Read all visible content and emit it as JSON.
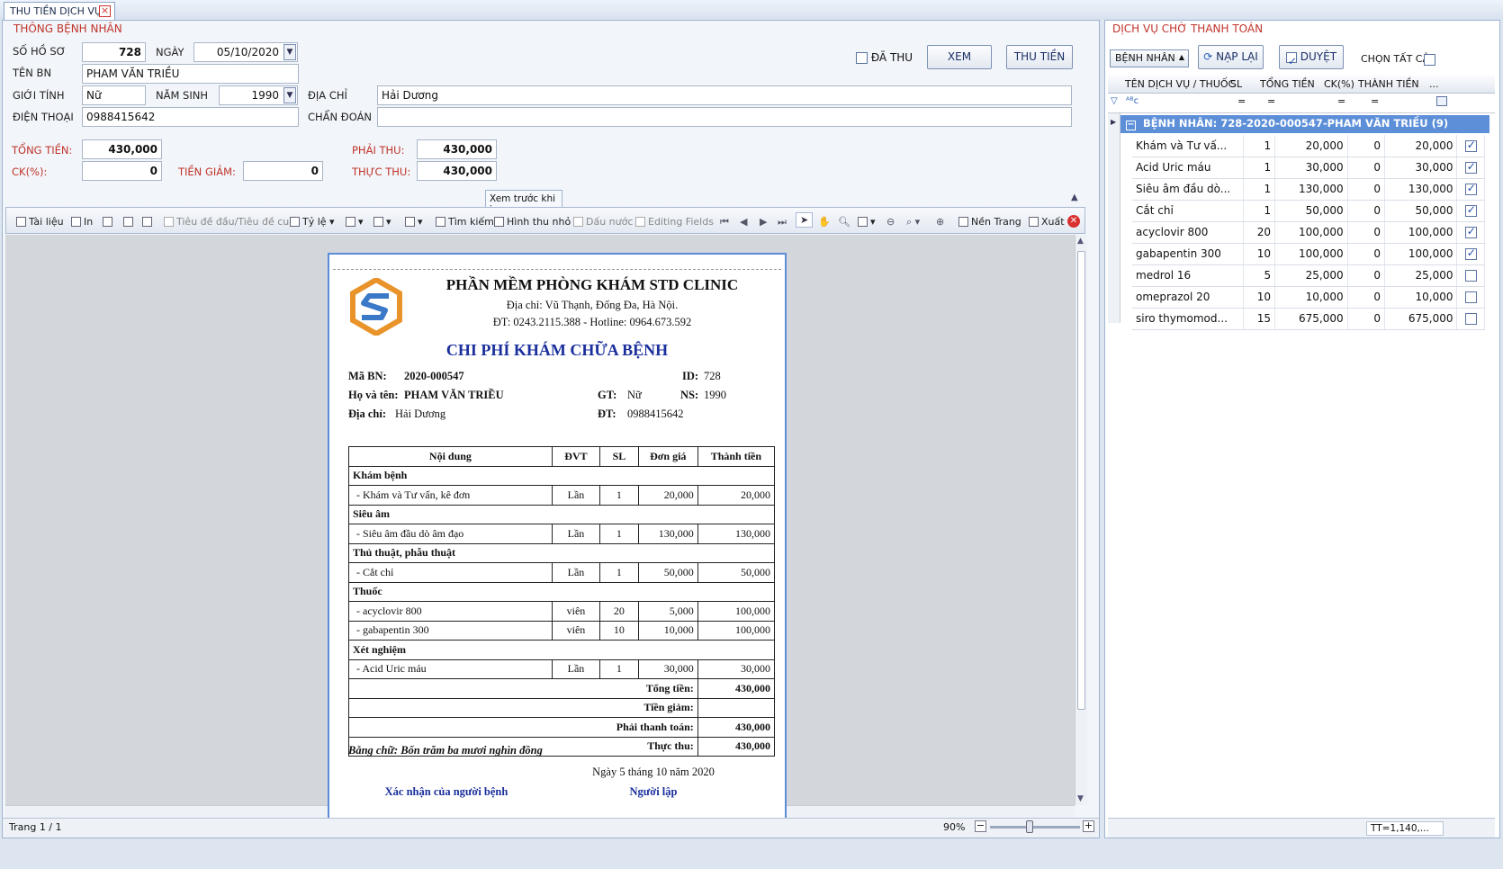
{
  "tab": {
    "title": "THU TIỀN DỊCH VỤ"
  },
  "patient": {
    "section_title": "THÔNG BỆNH NHÂN",
    "so_ho_so_label": "SỐ HỒ SƠ",
    "so_ho_so": "728",
    "ngay_label": "NGÀY",
    "ngay": "05/10/2020",
    "ten_bn_label": "TÊN BN",
    "ten_bn": "PHAM VĂN TRIỀU",
    "gioi_tinh_label": "GIỚI TÍNH",
    "gioi_tinh": "Nữ",
    "nam_sinh_label": "NĂM SINH",
    "nam_sinh": "1990",
    "dia_chi_label": "ĐỊA CHỈ",
    "dia_chi": "Hải Dương",
    "dien_thoai_label": "ĐIỆN THOẠI",
    "dien_thoai": "0988415642",
    "chan_doan_label": "CHẨN ĐOÁN",
    "chan_doan": "",
    "da_thu_label": "ĐÃ THU",
    "xem_btn": "XEM",
    "thu_tien_btn": "THU TIỀN"
  },
  "totals": {
    "tong_tien_label": "TỔNG TIỀN:",
    "tong_tien": "430,000",
    "ck_label": "CK(%):",
    "ck": "0",
    "tien_giam_label": "TIỀN GIẢM:",
    "tien_giam": "0",
    "phai_thu_label": "PHẢI THU:",
    "phai_thu": "430,000",
    "thuc_thu_label": "THỰC THU:",
    "thuc_thu": "430,000"
  },
  "preview": {
    "caption": "Xem trước khi in",
    "toolbar": {
      "tai_lieu": "Tài liệu",
      "in": "In",
      "tieu_de": "Tiêu đề đầu/Tiêu đề cuối",
      "ty_le": "Tỷ lệ",
      "tim_kiem": "Tìm kiếm",
      "hinh_thu_nho": "Hình thu nhỏ",
      "dau_nuoc": "Dấu nước",
      "editing_fields": "Editing Fields",
      "nen_trang": "Nền Trang",
      "xuat": "Xuất"
    },
    "status_page": "Trang 1 / 1",
    "zoom": "90%"
  },
  "report": {
    "clinic_name": "PHẦN MỀM PHÒNG KHÁM STD CLINIC",
    "address": "Địa chỉ: Vũ Thạnh, Đống Đa, Hà Nội.",
    "phone": "ĐT: 0243.2115.388 - Hotline: 0964.673.592",
    "title": "CHI PHÍ KHÁM CHỮA BỆNH",
    "ma_bn_label": "Mã BN:",
    "ma_bn": "2020-000547",
    "id_label": "ID:",
    "id": "728",
    "ho_ten_label": "Họ và tên:",
    "ho_ten": "PHAM VĂN TRIỀU",
    "gt_label": "GT:",
    "gt": "Nữ",
    "ns_label": "NS:",
    "ns": "1990",
    "dia_chi_label": "Địa chỉ:",
    "dia_chi": "Hải Dương",
    "dt_label": "ĐT:",
    "dt": "0988415642",
    "headers": [
      "Nội dung",
      "ĐVT",
      "SL",
      "Đơn giá",
      "Thành tiền"
    ],
    "rows": [
      {
        "group": "Khám bệnh"
      },
      {
        "name": "- Khám và Tư vấn, kê đơn",
        "unit": "Lần",
        "qty": "1",
        "price": "20,000",
        "total": "20,000"
      },
      {
        "group": "Siêu âm"
      },
      {
        "name": "- Siêu âm đầu dò âm đạo",
        "unit": "Lần",
        "qty": "1",
        "price": "130,000",
        "total": "130,000"
      },
      {
        "group": "Thủ thuật, phẫu thuật"
      },
      {
        "name": "- Cắt chỉ",
        "unit": "Lần",
        "qty": "1",
        "price": "50,000",
        "total": "50,000"
      },
      {
        "group": "Thuốc"
      },
      {
        "name": "- acyclovir 800",
        "unit": "viên",
        "qty": "20",
        "price": "5,000",
        "total": "100,000"
      },
      {
        "name": "- gabapentin 300",
        "unit": "viên",
        "qty": "10",
        "price": "10,000",
        "total": "100,000"
      },
      {
        "group": "Xét nghiệm"
      },
      {
        "name": "- Acid Uric máu",
        "unit": "Lần",
        "qty": "1",
        "price": "30,000",
        "total": "30,000"
      }
    ],
    "sum_rows": [
      {
        "label": "Tổng tiền:",
        "value": "430,000"
      },
      {
        "label": "Tiền giảm:",
        "value": ""
      },
      {
        "label": "Phải thanh toán:",
        "value": "430,000"
      },
      {
        "label": "Thực thu:",
        "value": "430,000"
      }
    ],
    "bang_chu": "Bằng chữ:  Bốn trăm ba mươi nghìn  đồng",
    "date_line": "Ngày 5 tháng 10 năm 2020",
    "sign_left": "Xác nhận của người bệnh",
    "sign_right": "Người lập"
  },
  "right": {
    "section_title": "DỊCH VỤ CHỜ THANH TOÁN",
    "filter_select": "BỆNH NHÂN",
    "nap_lai_btn": "NẠP LẠI",
    "duyet_btn": "DUYỆT",
    "chon_tat_ca": "CHỌN TẤT CẢ",
    "headers": [
      "TÊN DỊCH VỤ / THUỐC",
      "SL",
      "TỔNG TIỀN",
      "CK(%)",
      "THÀNH TIỀN",
      "..."
    ],
    "group_row": "BỆNH NHÂN: 728-2020-000547-PHAM VĂN TRIỀU  (9)",
    "items": [
      {
        "name": "Khám và Tư vấ...",
        "sl": "1",
        "tong": "20,000",
        "ck": "0",
        "thanh": "20,000",
        "checked": true
      },
      {
        "name": "Acid Uric máu",
        "sl": "1",
        "tong": "30,000",
        "ck": "0",
        "thanh": "30,000",
        "checked": true
      },
      {
        "name": "Siêu âm đầu dò...",
        "sl": "1",
        "tong": "130,000",
        "ck": "0",
        "thanh": "130,000",
        "checked": true
      },
      {
        "name": "Cắt chỉ",
        "sl": "1",
        "tong": "50,000",
        "ck": "0",
        "thanh": "50,000",
        "checked": true
      },
      {
        "name": "acyclovir 800",
        "sl": "20",
        "tong": "100,000",
        "ck": "0",
        "thanh": "100,000",
        "checked": true
      },
      {
        "name": "gabapentin 300",
        "sl": "10",
        "tong": "100,000",
        "ck": "0",
        "thanh": "100,000",
        "checked": true
      },
      {
        "name": "medrol 16",
        "sl": "5",
        "tong": "25,000",
        "ck": "0",
        "thanh": "25,000",
        "checked": false
      },
      {
        "name": "omeprazol 20",
        "sl": "10",
        "tong": "10,000",
        "ck": "0",
        "thanh": "10,000",
        "checked": false
      },
      {
        "name": "siro thymomod...",
        "sl": "15",
        "tong": "675,000",
        "ck": "0",
        "thanh": "675,000",
        "checked": false
      }
    ],
    "footer_sum": "TT=1,140,..."
  }
}
